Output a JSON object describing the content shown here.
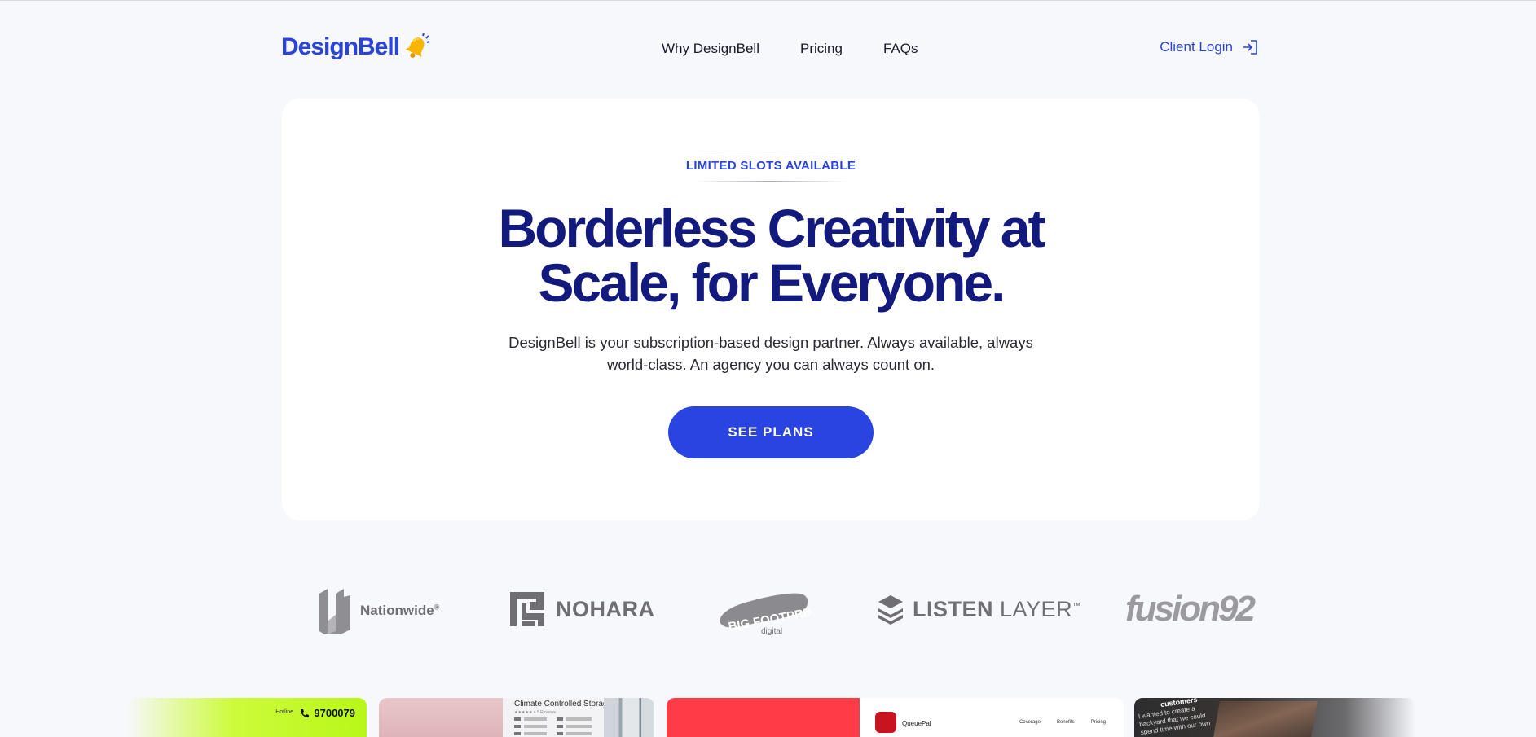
{
  "header": {
    "logo_text": "DesignBell",
    "nav_items": [
      "Why DesignBell",
      "Pricing",
      "FAQs"
    ],
    "login_label": "Client Login"
  },
  "hero": {
    "badge": "LIMITED SLOTS AVAILABLE",
    "title_line1": "Borderless Creativity at",
    "title_line2": "Scale, for Everyone.",
    "subtitle": "DesignBell is your subscription-based design partner. Always available, always world-class. An agency you can always count on.",
    "cta_label": "SEE  PLANS"
  },
  "client_logos": {
    "nationwide": "Nationwide",
    "nationwide_mark": "®",
    "nohara": "NOHARA",
    "bigfootprint": "BIG FOOTPRINT",
    "bigfootprint_sub": "digital",
    "listen_bold": "LISTEN",
    "listen_light": "LAYER",
    "listen_tm": "™",
    "fusion": "fusion92"
  },
  "portfolio": {
    "tile1_hotline": "Hotline",
    "tile1_phone": "9700079",
    "tile2_title": "Climate Controlled Storage",
    "tile2_rating": "★★★★★  4.5 Reviews",
    "tile3_app": "QueuePal",
    "tile3_nav": [
      "Coverage",
      "Benefits",
      "Pricing"
    ],
    "tile4_heading": "customers",
    "tile4_text": "I wanted to create a backyard that we could spend time with our own"
  },
  "colors": {
    "brand_blue": "#2a44d8",
    "title_navy": "#131a7e",
    "cta_blue": "#2a44e2",
    "page_bg": "#f7f8fc"
  },
  "icons": {
    "logo": "bell-icon",
    "login": "login-arrow-icon"
  }
}
